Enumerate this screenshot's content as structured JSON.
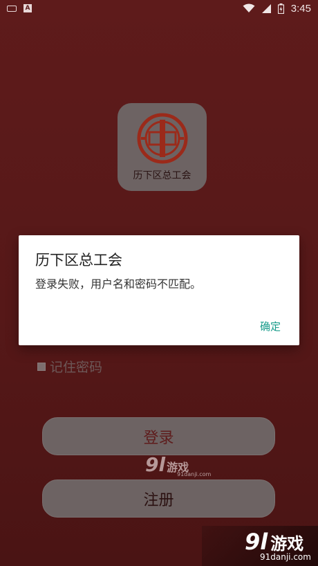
{
  "status_bar": {
    "time": "3:45",
    "left_icons": [
      "keyboard-icon",
      "a-badge-icon"
    ],
    "right_icons": [
      "wifi-icon",
      "signal-icon",
      "battery-icon"
    ]
  },
  "app": {
    "logo_label": "历下区总工会",
    "logo_color": "#9b2a1a"
  },
  "form": {
    "remember_label": "记住密码",
    "remember_checked": false,
    "login_label": "登录",
    "register_label": "注册"
  },
  "dialog": {
    "title": "历下区总工会",
    "message": "登录失败，用户名和密码不匹配。",
    "ok_label": "确定",
    "ok_color": "#179b8a"
  },
  "watermark": {
    "center_num": "9l",
    "center_text": "游戏",
    "center_site": "91danji.com",
    "corner_num": "9l",
    "corner_text": "游戏",
    "corner_site": "91danji.com"
  }
}
